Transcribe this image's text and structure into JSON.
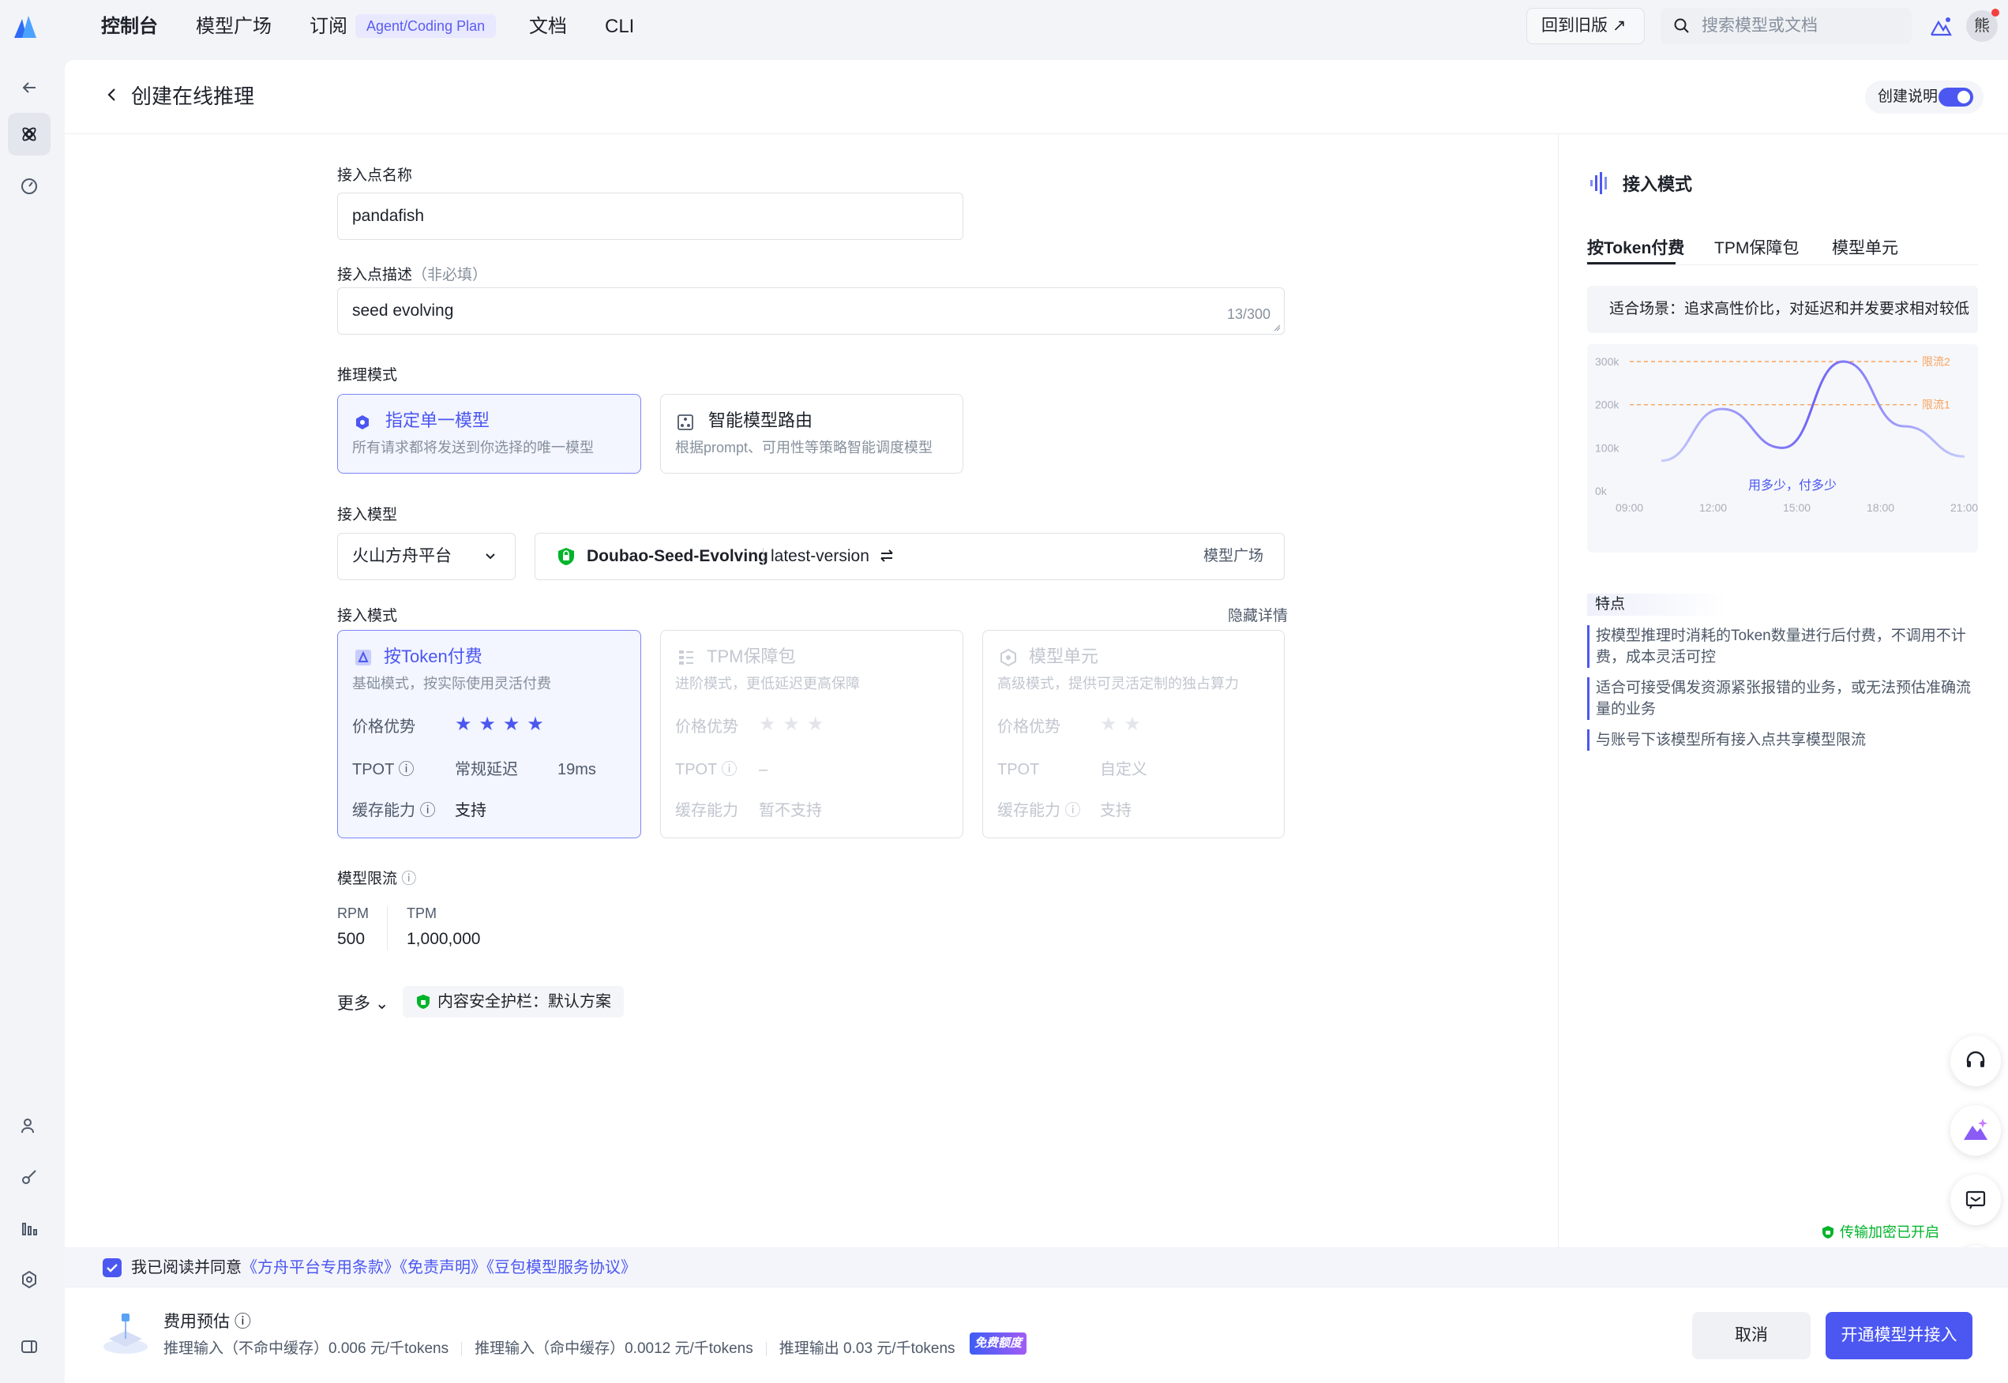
{
  "nav": {
    "items": [
      "控制台",
      "模型广场",
      "订阅",
      "文档",
      "CLI"
    ],
    "subscribe_badge": "Agent/Coding Plan",
    "old_version": "回到旧版 ↗",
    "search_placeholder": "搜索模型或文档",
    "avatar_text": "熊"
  },
  "header": {
    "title": "创建在线推理",
    "guide_label": "创建说明"
  },
  "form": {
    "endpoint_name_label": "接入点名称",
    "endpoint_name_value": "pandafish",
    "desc_label": "接入点描述",
    "desc_optional": "（非必填）",
    "desc_value": "seed evolving",
    "desc_count": "13/300",
    "inference_mode_label": "推理模式",
    "modes": [
      {
        "title": "指定单一模型",
        "sub": "所有请求都将发送到你选择的唯一模型"
      },
      {
        "title": "智能模型路由",
        "sub": "根据prompt、可用性等策略智能调度模型"
      }
    ],
    "model_label": "接入模型",
    "platform_value": "火山方舟平台",
    "model_name": "Doubao-Seed-Evolving",
    "model_version": "latest-version",
    "model_square": "模型广场",
    "access_mode_label": "接入模式",
    "hide_details": "隐藏详情",
    "access_cards": [
      {
        "title": "按Token付费",
        "sub": "基础模式，按实际使用灵活付费",
        "price_label": "价格优势",
        "tpot_label": "TPOT",
        "tpot_value": "常规延迟",
        "tpot_extra": "19ms",
        "cache_label": "缓存能力",
        "cache_value": "支持",
        "stars": 4
      },
      {
        "title": "TPM保障包",
        "sub": "进阶模式，更低延迟更高保障",
        "price_label": "价格优势",
        "tpot_label": "TPOT",
        "tpot_value": "–",
        "cache_label": "缓存能力",
        "cache_value": "暂不支持",
        "stars": 3
      },
      {
        "title": "模型单元",
        "sub": "高级模式，提供可灵活定制的独占算力",
        "price_label": "价格优势",
        "tpot_label": "TPOT",
        "tpot_value": "自定义",
        "cache_label": "缓存能力",
        "cache_value": "支持",
        "stars": 2
      }
    ],
    "limit_label": "模型限流",
    "rpm_label": "RPM",
    "rpm_value": "500",
    "tpm_label": "TPM",
    "tpm_value": "1,000,000",
    "more_label": "更多",
    "guard_label": "内容安全护栏：默认方案"
  },
  "right": {
    "title": "接入模式",
    "tabs": [
      "按Token付费",
      "TPM保障包",
      "模型单元"
    ],
    "scenario": "适合场景：追求高性价比，对延迟和并发要求相对较低",
    "chart_y_ticks": [
      "300k",
      "200k",
      "100k",
      "0k"
    ],
    "chart_x_ticks": [
      "09:00",
      "12:00",
      "15:00",
      "18:00",
      "21:00"
    ],
    "limit2": "限流2",
    "limit1": "限流1",
    "chart_caption": "用多少，付多少",
    "features_title": "特点",
    "features": [
      "按模型推理时消耗的Token数量进行后付费，不调用不计费，成本灵活可控",
      "适合可接受偶发资源紧张报错的业务，或无法预估准确流量的业务",
      "与账号下该模型所有接入点共享模型限流"
    ],
    "encrypt": "传输加密已开启"
  },
  "footer": {
    "agree_prefix": "我已阅读并同意",
    "agree_links": [
      "《方舟平台专用条款》",
      "《免责声明》",
      "《豆包模型服务协议》"
    ],
    "cost_title": "费用预估",
    "cost_items": [
      "推理输入（不命中缓存）0.006 元/千tokens",
      "推理输入（命中缓存）0.0012 元/千tokens",
      "推理输出 0.03 元/千tokens"
    ],
    "free_badge": "免费额度",
    "cancel": "取消",
    "submit": "开通模型并接入"
  },
  "colors": {
    "accent": "#4b57f0",
    "success": "#00b42a",
    "limit_line": "#f7a35c"
  },
  "chart_data": {
    "type": "line",
    "x": [
      "09:00",
      "12:00",
      "15:00",
      "18:00",
      "21:00"
    ],
    "ylim": [
      0,
      300
    ],
    "series": [
      {
        "values": [
          70,
          190,
          100,
          300,
          150,
          80
        ]
      }
    ],
    "thresholds": {
      "限流2": 300,
      "限流1": 200
    }
  }
}
